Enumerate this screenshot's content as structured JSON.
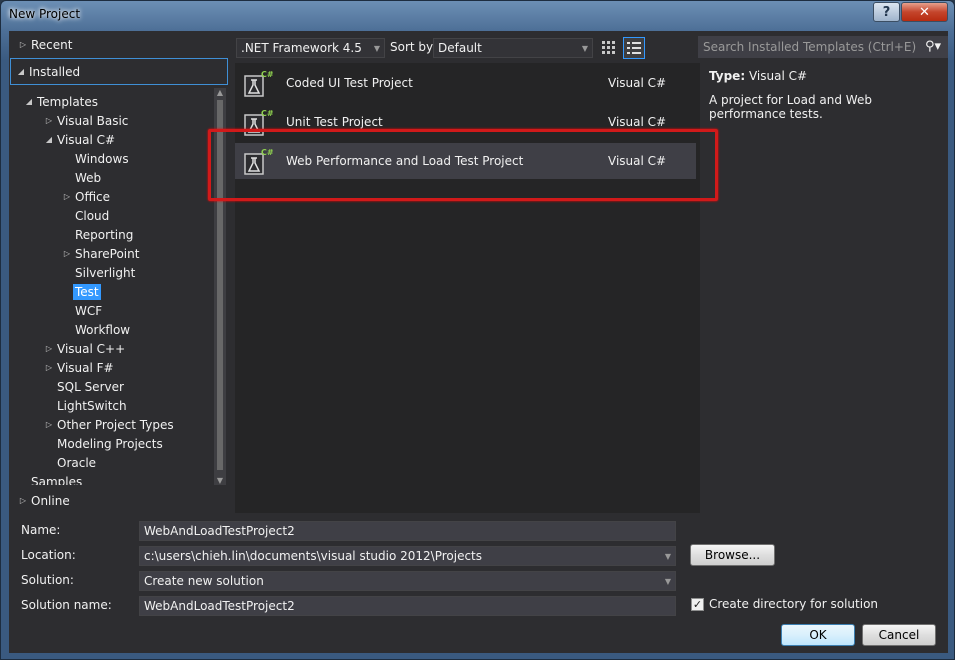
{
  "window": {
    "title": "New Project",
    "help_glyph": "?",
    "close_glyph": "✕"
  },
  "nav": {
    "recent": "Recent",
    "installed": "Installed",
    "online": "Online",
    "tree": [
      {
        "label": "Templates",
        "level": 1,
        "arrow": "open"
      },
      {
        "label": "Visual Basic",
        "level": 2,
        "arrow": "closed"
      },
      {
        "label": "Visual C#",
        "level": 2,
        "arrow": "open"
      },
      {
        "label": "Windows",
        "level": 3,
        "arrow": "none"
      },
      {
        "label": "Web",
        "level": 3,
        "arrow": "none"
      },
      {
        "label": "Office",
        "level": 3,
        "arrow": "closed"
      },
      {
        "label": "Cloud",
        "level": 3,
        "arrow": "none"
      },
      {
        "label": "Reporting",
        "level": 3,
        "arrow": "none"
      },
      {
        "label": "SharePoint",
        "level": 3,
        "arrow": "closed"
      },
      {
        "label": "Silverlight",
        "level": 3,
        "arrow": "none"
      },
      {
        "label": "Test",
        "level": 3,
        "arrow": "none",
        "selected": true
      },
      {
        "label": "WCF",
        "level": 3,
        "arrow": "none"
      },
      {
        "label": "Workflow",
        "level": 3,
        "arrow": "none"
      },
      {
        "label": "Visual C++",
        "level": 2,
        "arrow": "closed"
      },
      {
        "label": "Visual F#",
        "level": 2,
        "arrow": "closed"
      },
      {
        "label": "SQL Server",
        "level": 2,
        "arrow": "none"
      },
      {
        "label": "LightSwitch",
        "level": 2,
        "arrow": "none"
      },
      {
        "label": "Other Project Types",
        "level": 2,
        "arrow": "closed"
      },
      {
        "label": "Modeling Projects",
        "level": 2,
        "arrow": "none"
      },
      {
        "label": "Oracle",
        "level": 2,
        "arrow": "none"
      }
    ],
    "partial_item": "Samples"
  },
  "toolbar": {
    "framework": ".NET Framework 4.5",
    "sort_label": "Sort by:",
    "sort_value": "Default"
  },
  "search": {
    "placeholder": "Search Installed Templates (Ctrl+E)"
  },
  "templates": [
    {
      "name": "Coded UI Test Project",
      "language": "Visual C#"
    },
    {
      "name": "Unit Test Project",
      "language": "Visual C#"
    },
    {
      "name": "Web Performance and Load Test Project",
      "language": "Visual C#",
      "selected": true
    }
  ],
  "template_icon_badge": "C#",
  "details": {
    "type_label": "Type:",
    "type_value": "Visual C#",
    "description": "A project for Load and Web performance tests."
  },
  "form": {
    "name_label": "Name:",
    "name_value": "WebAndLoadTestProject2",
    "location_label": "Location:",
    "location_value": "c:\\users\\chieh.lin\\documents\\visual studio 2012\\Projects",
    "solution_label": "Solution:",
    "solution_value": "Create new solution",
    "solution_name_label": "Solution name:",
    "solution_name_value": "WebAndLoadTestProject2",
    "browse_label": "Browse...",
    "create_dir_label": "Create directory for solution",
    "create_dir_checked": true,
    "ok_label": "OK",
    "cancel_label": "Cancel"
  },
  "colors": {
    "accent": "#3399ff",
    "highlight_box": "#d11a1a",
    "background": "#2d2d30"
  }
}
